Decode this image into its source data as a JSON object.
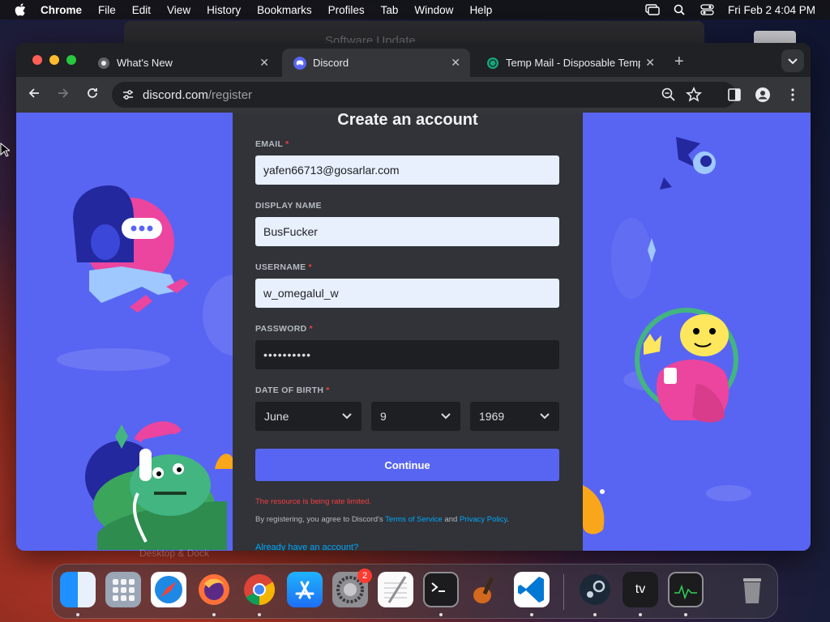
{
  "menubar": {
    "app_name": "Chrome",
    "items": [
      "File",
      "Edit",
      "View",
      "History",
      "Bookmarks",
      "Profiles",
      "Tab",
      "Window",
      "Help"
    ],
    "datetime": "Fri Feb 2  4:04 PM"
  },
  "background_window": {
    "title": "Software Update"
  },
  "tabs": [
    {
      "label": "What's New",
      "icon": "chrome-icon"
    },
    {
      "label": "Discord",
      "icon": "discord-icon"
    },
    {
      "label": "Temp Mail - Disposable Temp",
      "icon": "tempmail-icon"
    }
  ],
  "address_bar": {
    "host": "discord.com",
    "path": "/register"
  },
  "form": {
    "title": "Create an account",
    "email_label": "EMAIL",
    "email_value": "yafen66713@gosarlar.com",
    "display_name_label": "DISPLAY NAME",
    "display_name_value": "BusFucker",
    "username_label": "USERNAME",
    "username_value": "w_omegalul_w",
    "password_label": "PASSWORD",
    "password_value": "••••••••••",
    "dob_label": "DATE OF BIRTH",
    "dob_month": "June",
    "dob_day": "9",
    "dob_year": "1969",
    "required_mark": "*",
    "continue_label": "Continue",
    "error_text": "The resource is being rate limited.",
    "terms_prefix": "By registering, you agree to Discord's ",
    "terms_link": "Terms of Service",
    "terms_and": " and ",
    "privacy_link": "Privacy Policy",
    "terms_suffix": ".",
    "login_link": "Already have an account?"
  },
  "dock": {
    "ghost_label": "Desktop & Dock",
    "badge_count": "2",
    "items": [
      "finder-icon",
      "launchpad-icon",
      "safari-icon",
      "firefox-icon",
      "chrome-icon",
      "app-store-icon",
      "system-settings-icon",
      "textedit-icon",
      "terminal-icon",
      "garageband-icon",
      "vscode-icon",
      "steam-icon",
      "apple-tv-icon",
      "activity-monitor-icon",
      "trash-icon"
    ],
    "tv_label": "tv"
  },
  "colors": {
    "discord_blurple": "#5865f2",
    "card_bg": "#313338",
    "error": "#f23f43",
    "link": "#00a8fc"
  }
}
